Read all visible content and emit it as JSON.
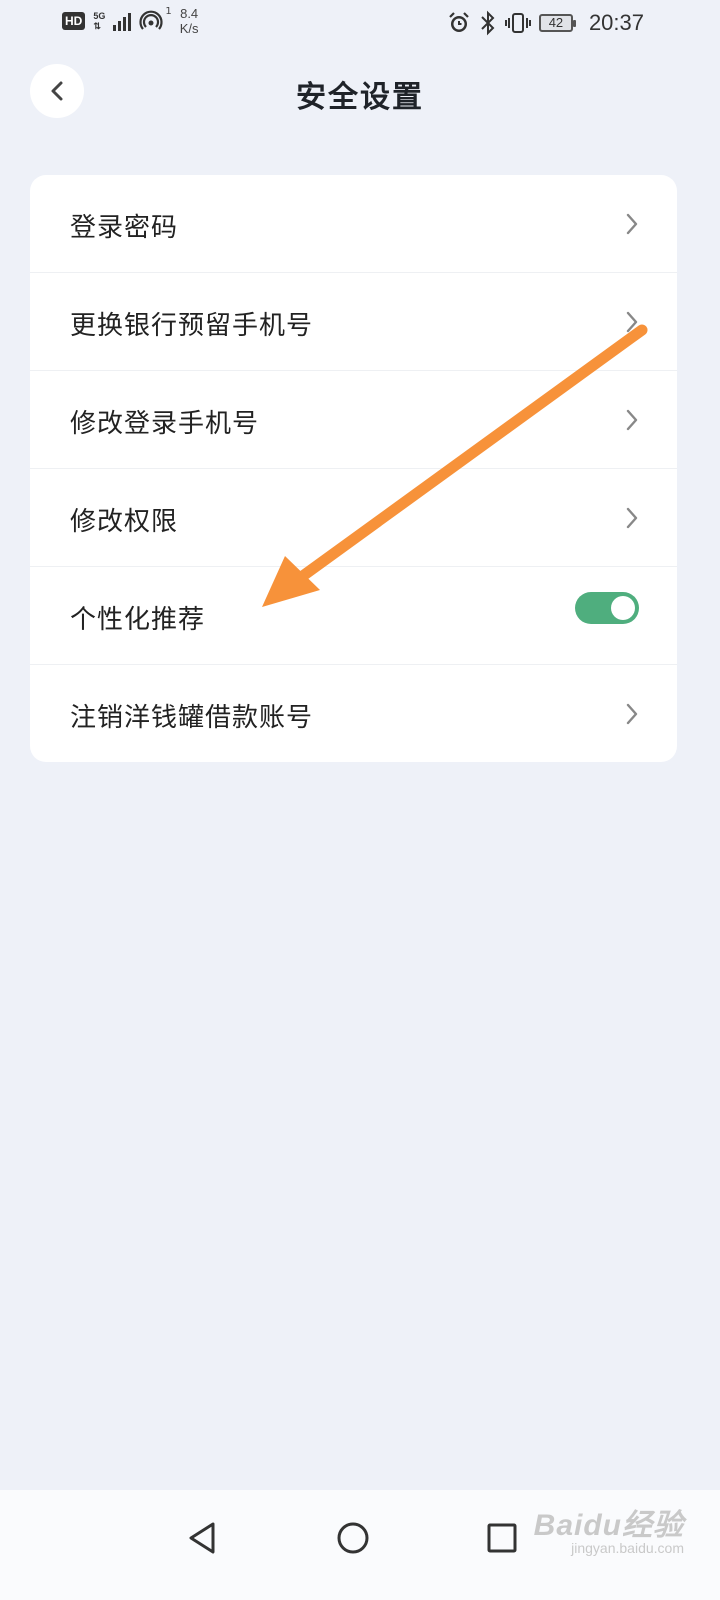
{
  "status_bar": {
    "hd": "HD",
    "network": "5G",
    "hotspot_count": "1",
    "speed_value": "8.4",
    "speed_unit": "K/s",
    "battery": "42",
    "time": "20:37",
    "icons": [
      "hd-icon",
      "signal-icon",
      "hotspot-icon",
      "alarm-icon",
      "bluetooth-icon",
      "vibrate-icon",
      "battery-icon"
    ]
  },
  "header": {
    "title": "安全设置",
    "back_icon": "chevron-left-icon"
  },
  "settings": {
    "items": [
      {
        "label": "登录密码",
        "control": "chevron"
      },
      {
        "label": "更换银行预留手机号",
        "control": "chevron"
      },
      {
        "label": "修改登录手机号",
        "control": "chevron"
      },
      {
        "label": "修改权限",
        "control": "chevron"
      },
      {
        "label": "个性化推荐",
        "control": "toggle",
        "toggle_on": true
      },
      {
        "label": "注销洋钱罐借款账号",
        "control": "chevron"
      }
    ]
  },
  "colors": {
    "background": "#eef1f8",
    "toggle_on": "#4fae7e",
    "annotation_arrow": "#f7923a"
  },
  "nav_bar": {
    "icons": [
      "back-triangle-icon",
      "home-circle-icon",
      "recents-square-icon"
    ]
  },
  "watermark": {
    "main": "Baidu经验",
    "sub": "jingyan.baidu.com"
  }
}
